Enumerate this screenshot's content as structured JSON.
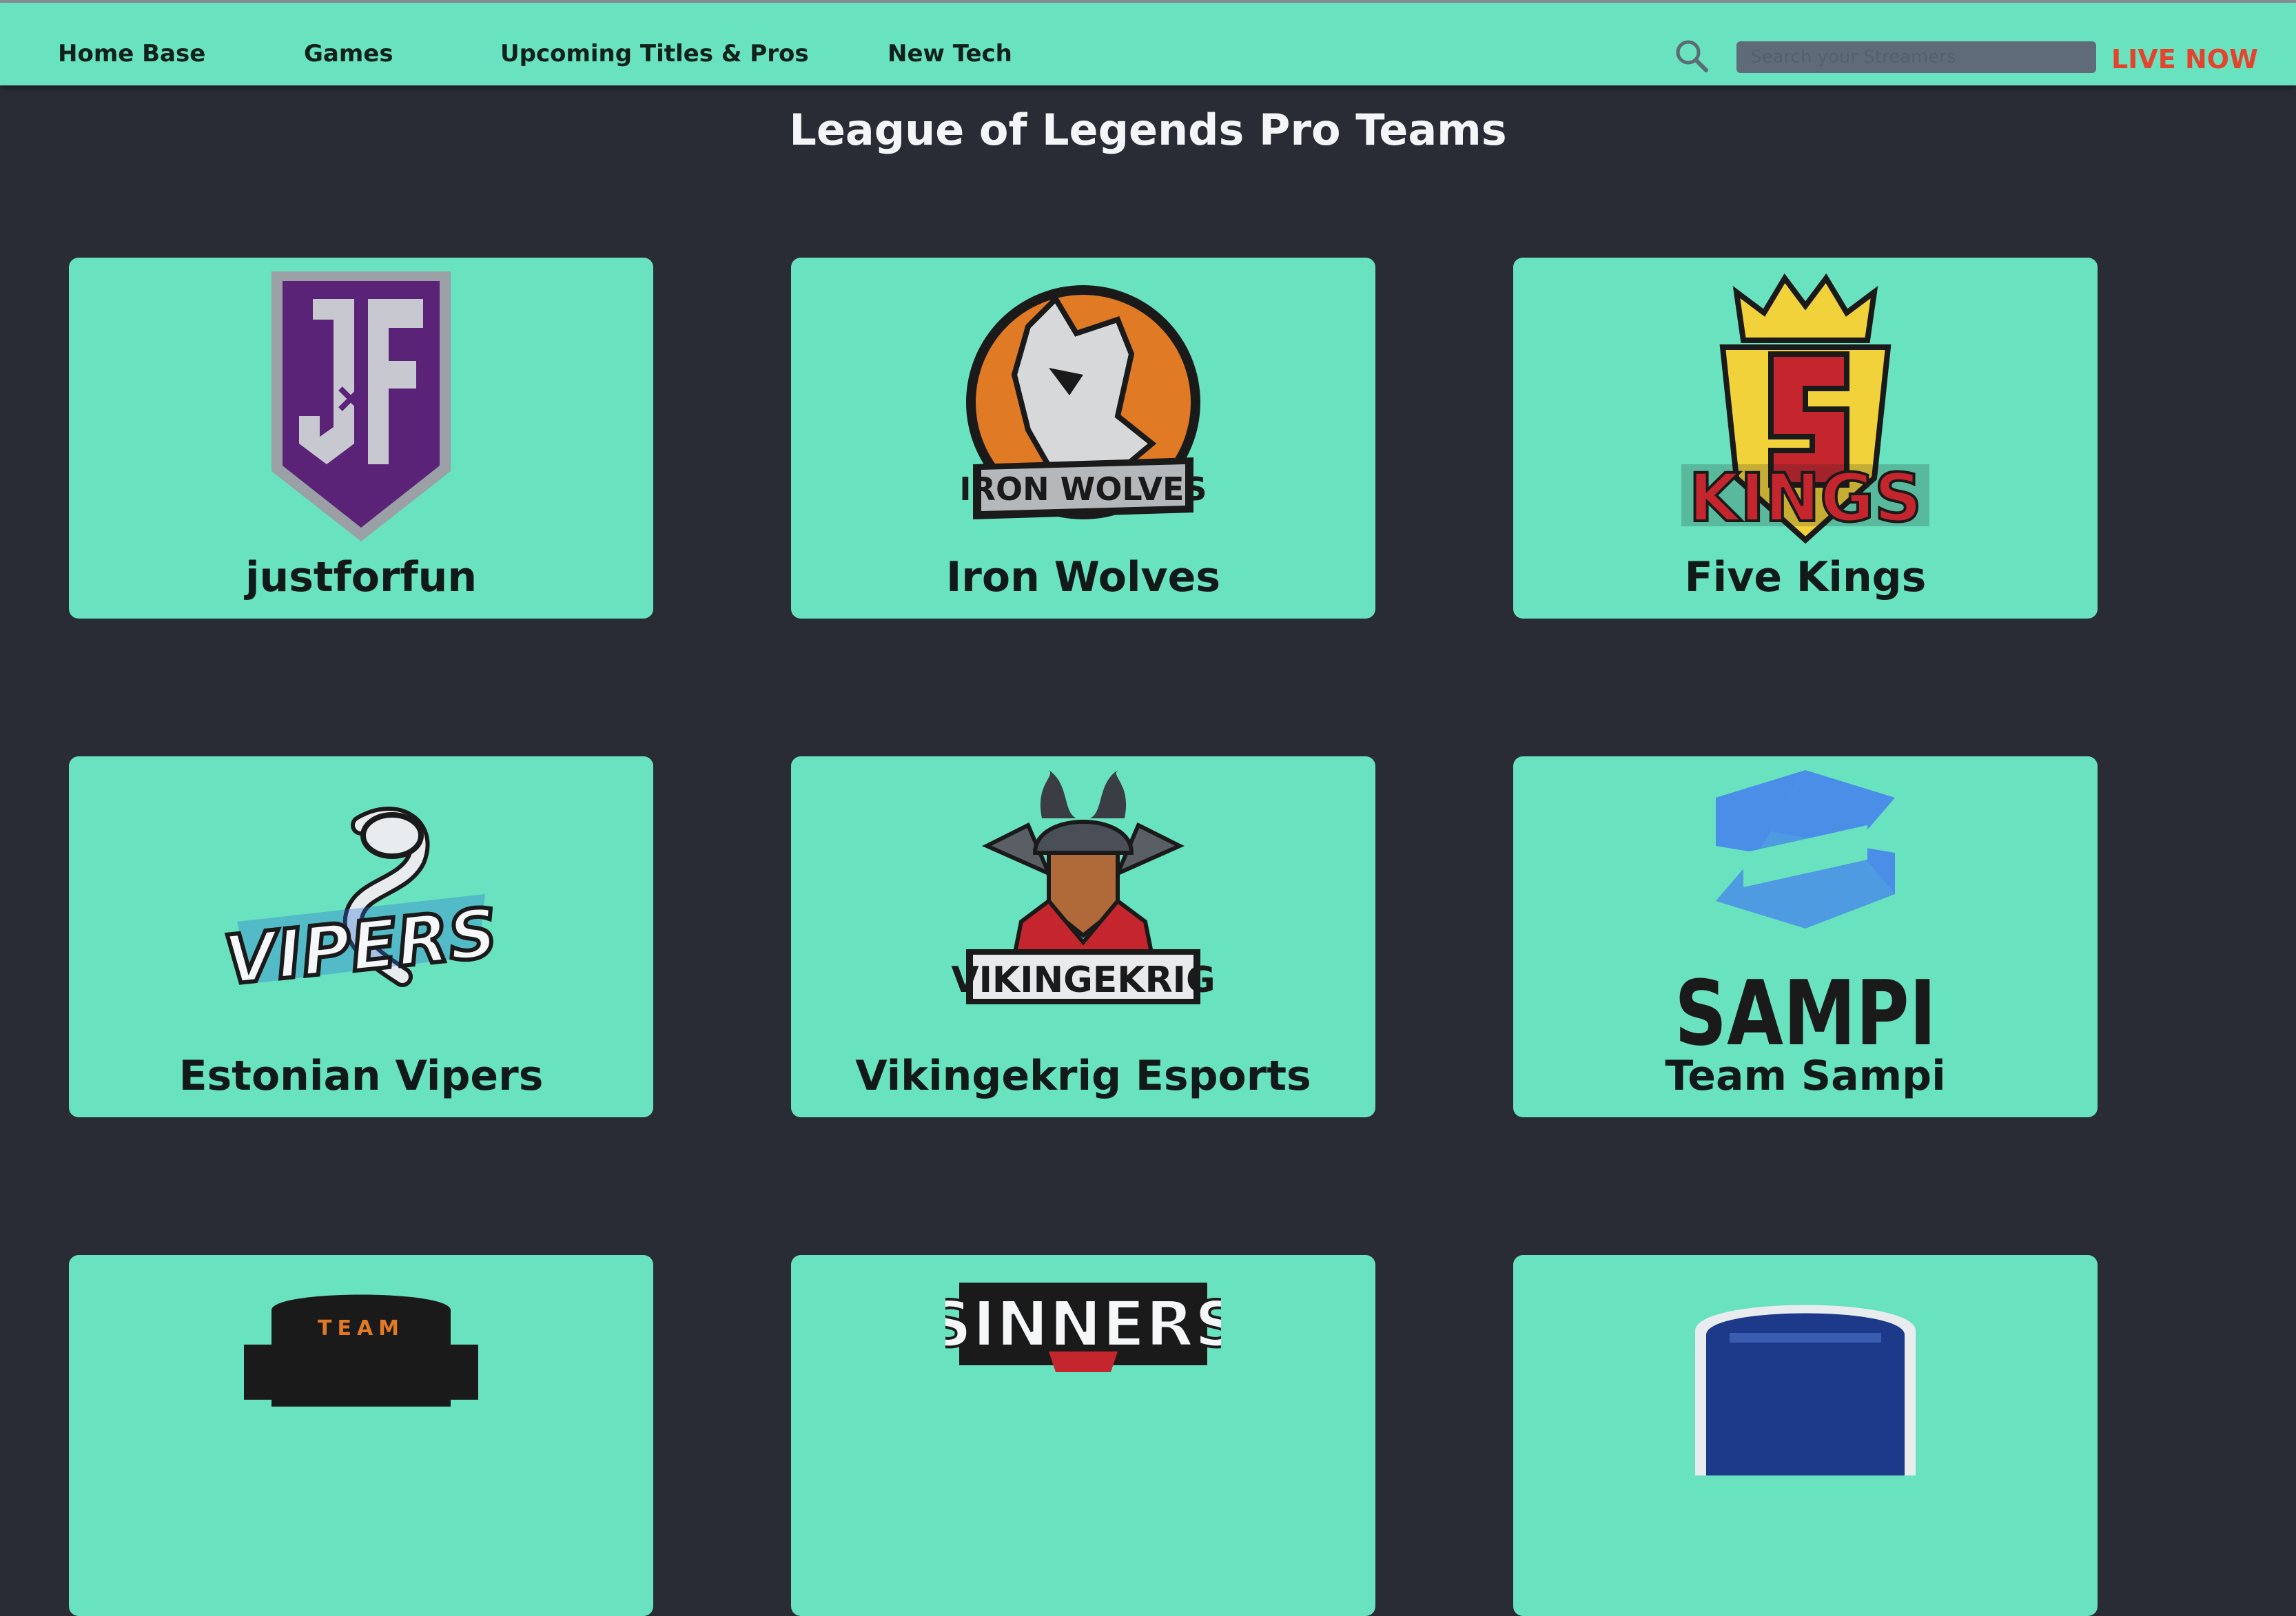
{
  "nav": {
    "items": [
      {
        "label": "Home Base"
      },
      {
        "label": "Games"
      },
      {
        "label": "Upcoming Titles & Pros"
      },
      {
        "label": "New Tech"
      }
    ],
    "search_icon": "search-icon",
    "search_placeholder": "Search your Streamers",
    "live_label": "LIVE NOW"
  },
  "page": {
    "title": "League of Legends Pro Teams"
  },
  "teams": [
    {
      "name": "justforfun",
      "logo": "jf-shield-logo",
      "logo_text": "JF"
    },
    {
      "name": "Iron Wolves",
      "logo": "iron-wolves-logo",
      "logo_text": "IRON WOLVES"
    },
    {
      "name": "Five Kings",
      "logo": "five-kings-logo",
      "logo_text": "KINGS"
    },
    {
      "name": "Estonian Vipers",
      "logo": "vipers-logo",
      "logo_text": "VIPERS"
    },
    {
      "name": "Vikingekrig Esports",
      "logo": "vikingekrig-logo",
      "logo_text": "VIKINGEKRIG"
    },
    {
      "name": "Team Sampi",
      "logo": "sampi-logo",
      "logo_text": "SAMPI"
    },
    {
      "name": "",
      "logo": "team-brute-logo",
      "logo_text": "TEAM"
    },
    {
      "name": "",
      "logo": "sinners-logo",
      "logo_text": "SINNERS"
    },
    {
      "name": "",
      "logo": "blue-crest-logo",
      "logo_text": ""
    }
  ],
  "colors": {
    "background": "#292c34",
    "accent": "#69e2bf",
    "live": "#e4432d"
  }
}
